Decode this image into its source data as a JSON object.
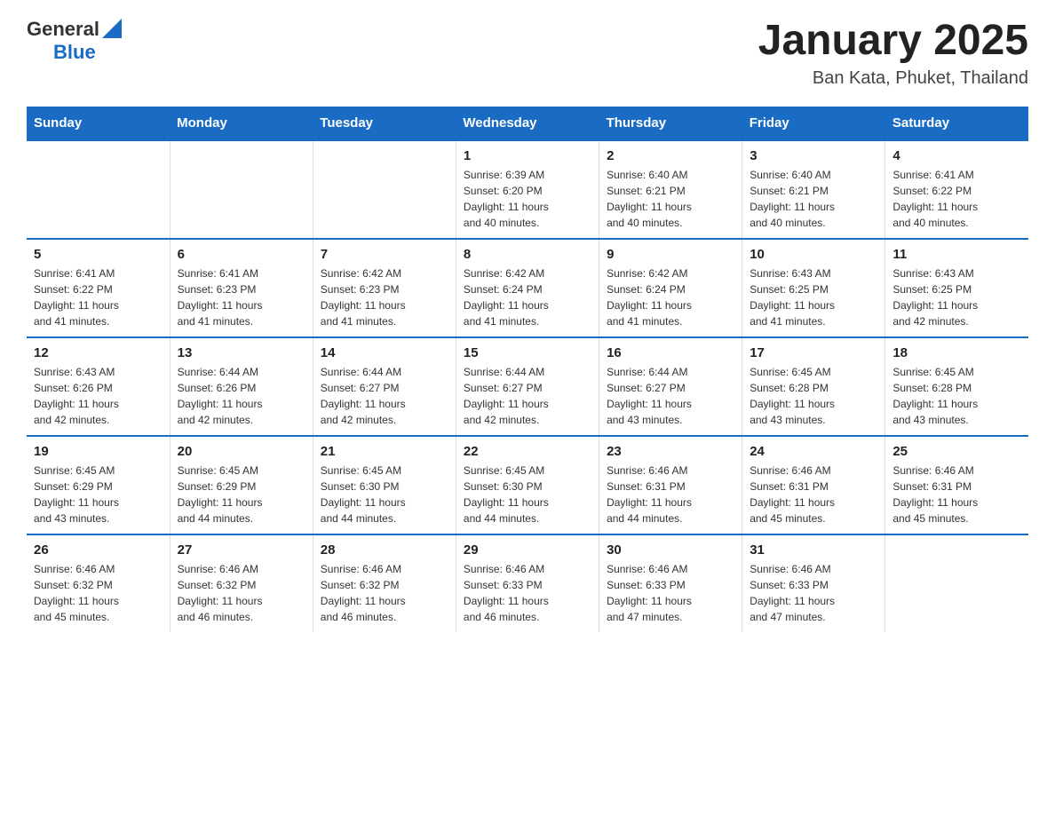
{
  "logo": {
    "general": "General",
    "blue": "Blue"
  },
  "title": "January 2025",
  "subtitle": "Ban Kata, Phuket, Thailand",
  "days_of_week": [
    "Sunday",
    "Monday",
    "Tuesday",
    "Wednesday",
    "Thursday",
    "Friday",
    "Saturday"
  ],
  "weeks": [
    [
      {
        "day": "",
        "info": ""
      },
      {
        "day": "",
        "info": ""
      },
      {
        "day": "",
        "info": ""
      },
      {
        "day": "1",
        "info": "Sunrise: 6:39 AM\nSunset: 6:20 PM\nDaylight: 11 hours\nand 40 minutes."
      },
      {
        "day": "2",
        "info": "Sunrise: 6:40 AM\nSunset: 6:21 PM\nDaylight: 11 hours\nand 40 minutes."
      },
      {
        "day": "3",
        "info": "Sunrise: 6:40 AM\nSunset: 6:21 PM\nDaylight: 11 hours\nand 40 minutes."
      },
      {
        "day": "4",
        "info": "Sunrise: 6:41 AM\nSunset: 6:22 PM\nDaylight: 11 hours\nand 40 minutes."
      }
    ],
    [
      {
        "day": "5",
        "info": "Sunrise: 6:41 AM\nSunset: 6:22 PM\nDaylight: 11 hours\nand 41 minutes."
      },
      {
        "day": "6",
        "info": "Sunrise: 6:41 AM\nSunset: 6:23 PM\nDaylight: 11 hours\nand 41 minutes."
      },
      {
        "day": "7",
        "info": "Sunrise: 6:42 AM\nSunset: 6:23 PM\nDaylight: 11 hours\nand 41 minutes."
      },
      {
        "day": "8",
        "info": "Sunrise: 6:42 AM\nSunset: 6:24 PM\nDaylight: 11 hours\nand 41 minutes."
      },
      {
        "day": "9",
        "info": "Sunrise: 6:42 AM\nSunset: 6:24 PM\nDaylight: 11 hours\nand 41 minutes."
      },
      {
        "day": "10",
        "info": "Sunrise: 6:43 AM\nSunset: 6:25 PM\nDaylight: 11 hours\nand 41 minutes."
      },
      {
        "day": "11",
        "info": "Sunrise: 6:43 AM\nSunset: 6:25 PM\nDaylight: 11 hours\nand 42 minutes."
      }
    ],
    [
      {
        "day": "12",
        "info": "Sunrise: 6:43 AM\nSunset: 6:26 PM\nDaylight: 11 hours\nand 42 minutes."
      },
      {
        "day": "13",
        "info": "Sunrise: 6:44 AM\nSunset: 6:26 PM\nDaylight: 11 hours\nand 42 minutes."
      },
      {
        "day": "14",
        "info": "Sunrise: 6:44 AM\nSunset: 6:27 PM\nDaylight: 11 hours\nand 42 minutes."
      },
      {
        "day": "15",
        "info": "Sunrise: 6:44 AM\nSunset: 6:27 PM\nDaylight: 11 hours\nand 42 minutes."
      },
      {
        "day": "16",
        "info": "Sunrise: 6:44 AM\nSunset: 6:27 PM\nDaylight: 11 hours\nand 43 minutes."
      },
      {
        "day": "17",
        "info": "Sunrise: 6:45 AM\nSunset: 6:28 PM\nDaylight: 11 hours\nand 43 minutes."
      },
      {
        "day": "18",
        "info": "Sunrise: 6:45 AM\nSunset: 6:28 PM\nDaylight: 11 hours\nand 43 minutes."
      }
    ],
    [
      {
        "day": "19",
        "info": "Sunrise: 6:45 AM\nSunset: 6:29 PM\nDaylight: 11 hours\nand 43 minutes."
      },
      {
        "day": "20",
        "info": "Sunrise: 6:45 AM\nSunset: 6:29 PM\nDaylight: 11 hours\nand 44 minutes."
      },
      {
        "day": "21",
        "info": "Sunrise: 6:45 AM\nSunset: 6:30 PM\nDaylight: 11 hours\nand 44 minutes."
      },
      {
        "day": "22",
        "info": "Sunrise: 6:45 AM\nSunset: 6:30 PM\nDaylight: 11 hours\nand 44 minutes."
      },
      {
        "day": "23",
        "info": "Sunrise: 6:46 AM\nSunset: 6:31 PM\nDaylight: 11 hours\nand 44 minutes."
      },
      {
        "day": "24",
        "info": "Sunrise: 6:46 AM\nSunset: 6:31 PM\nDaylight: 11 hours\nand 45 minutes."
      },
      {
        "day": "25",
        "info": "Sunrise: 6:46 AM\nSunset: 6:31 PM\nDaylight: 11 hours\nand 45 minutes."
      }
    ],
    [
      {
        "day": "26",
        "info": "Sunrise: 6:46 AM\nSunset: 6:32 PM\nDaylight: 11 hours\nand 45 minutes."
      },
      {
        "day": "27",
        "info": "Sunrise: 6:46 AM\nSunset: 6:32 PM\nDaylight: 11 hours\nand 46 minutes."
      },
      {
        "day": "28",
        "info": "Sunrise: 6:46 AM\nSunset: 6:32 PM\nDaylight: 11 hours\nand 46 minutes."
      },
      {
        "day": "29",
        "info": "Sunrise: 6:46 AM\nSunset: 6:33 PM\nDaylight: 11 hours\nand 46 minutes."
      },
      {
        "day": "30",
        "info": "Sunrise: 6:46 AM\nSunset: 6:33 PM\nDaylight: 11 hours\nand 47 minutes."
      },
      {
        "day": "31",
        "info": "Sunrise: 6:46 AM\nSunset: 6:33 PM\nDaylight: 11 hours\nand 47 minutes."
      },
      {
        "day": "",
        "info": ""
      }
    ]
  ]
}
